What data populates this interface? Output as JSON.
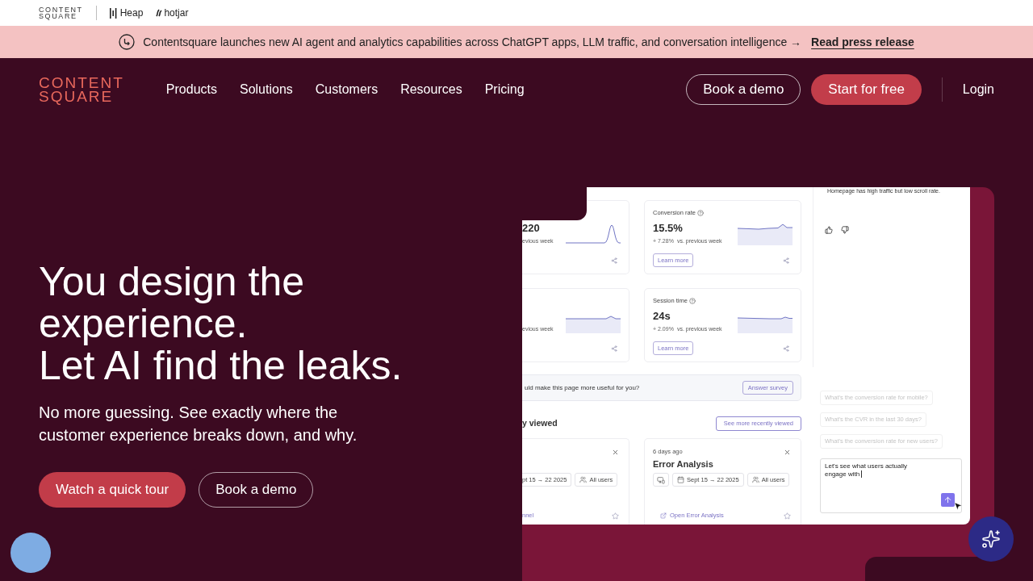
{
  "top_bar": {
    "brands": [
      {
        "kind": "contentsquare",
        "lines": [
          "CONTENT",
          "SQUARE"
        ]
      },
      {
        "kind": "heap",
        "lines": [
          "Heap"
        ]
      },
      {
        "kind": "hotjar",
        "lines": [
          "hotjar"
        ]
      }
    ]
  },
  "announcement": {
    "text": "Contentsquare launches new AI agent and analytics capabilities across ChatGPT apps, LLM traffic, and conversation intelligence →",
    "link": "Read press release"
  },
  "nav": {
    "logo": [
      "CONTENT",
      "SQUARE"
    ],
    "items": [
      "Products",
      "Solutions",
      "Customers",
      "Resources",
      "Pricing"
    ],
    "actions": [
      {
        "kind": "outline",
        "label": "Book a demo"
      },
      {
        "kind": "primary",
        "label": "Start for free"
      },
      {
        "kind": "link",
        "label": "Login"
      }
    ]
  },
  "hero": {
    "heading": [
      "You design the experience.",
      "Let AI find the leaks."
    ],
    "subtitle": "No more guessing. See exactly where the customer experience breaks down, and why.",
    "buttons": [
      {
        "kind": "primary",
        "label": "Watch a quick tour"
      },
      {
        "kind": "outline",
        "label": "Book a demo"
      }
    ]
  },
  "preview": {
    "metric_cards": [
      {
        "kind": "clipped",
        "value": "220",
        "comparison": "evious week"
      },
      {
        "kind": "full",
        "title": "Conversion rate",
        "value": "15.5%",
        "change": "+ 7.28%",
        "comparison": "vs. previous week",
        "button": "Learn more"
      },
      {
        "kind": "clipped",
        "comparison": "evious week"
      },
      {
        "kind": "full",
        "title": "Session time",
        "value": "24s",
        "change": "+ 2.09%",
        "comparison": "vs. previous week",
        "button": "Learn more"
      }
    ],
    "survey": {
      "question": "uld make this page more useful for you?",
      "button": "Answer survey"
    },
    "recently_viewed": {
      "heading": "y viewed",
      "button": "See more recently viewed",
      "items": [
        {
          "kind": "clipped",
          "date_range": "pt 15 → 22 2025",
          "audience": "All users",
          "link": "nnel"
        },
        {
          "kind": "full",
          "age": "6 days ago",
          "title": "Error Analysis",
          "date_range": "Sept 15 → 22 2025",
          "audience": "All users",
          "link": "Open Error Analysis"
        }
      ]
    },
    "assistant": {
      "message": "Homepage has high traffic but low scroll rate.",
      "suggestions": [
        "What's the conversion rate for mobile?",
        "What's the CVR in the last 30 days?",
        "What's the conversion rate for new users?"
      ],
      "input": {
        "value": "Let's see what users actually engage with"
      }
    }
  }
}
